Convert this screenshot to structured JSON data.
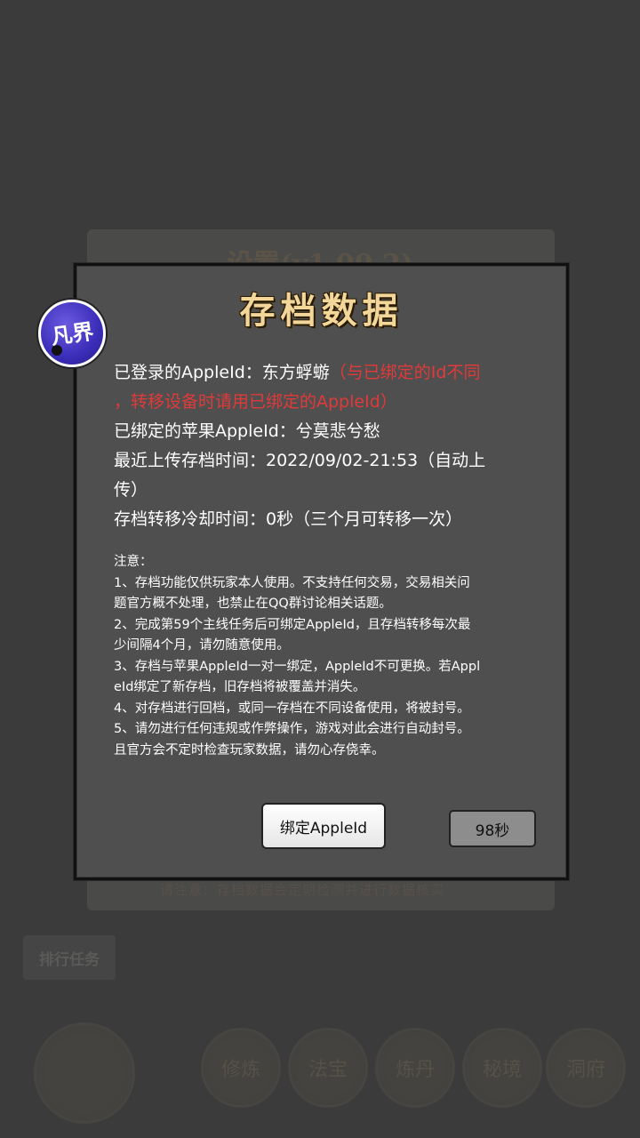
{
  "background": {
    "title": "设置(v1.00.2)",
    "hint": "请注意：存档数据会定期检测并进行数据核实",
    "button_label": "排行任务",
    "circle_labels": [
      "修炼",
      "法宝",
      "炼丹",
      "秘境",
      "洞府"
    ]
  },
  "dialog": {
    "title": "存档数据",
    "avatar_text": "凡界",
    "logged_in_label": "已登录的AppleId：",
    "logged_in_value": "东方蜉蝣",
    "logged_in_warning_1": "（与已绑定的Id不同",
    "logged_in_warning_2": "，转移设备时请用已绑定的AppleId）",
    "bound_line": "已绑定的苹果AppleId：兮莫悲兮愁",
    "upload_line_1": "最近上传存档时间：2022/09/02-21:53（自动上",
    "upload_line_2": "传）",
    "cooldown_line": "存档转移冷却时间：0秒（三个月可转移一次）",
    "notes": [
      "注意：",
      "1、存档功能仅供玩家本人使用。不支持任何交易，交易相关问",
      "题官方概不处理，也禁止在QQ群讨论相关话题。",
      "2、完成第59个主线任务后可绑定AppleId，且存档转移每次最",
      "少间隔4个月，请勿随意使用。",
      "3、存档与苹果AppleId一对一绑定，AppleId不可更换。若Appl",
      "eId绑定了新存档，旧存档将被覆盖并消失。",
      "4、对存档进行回档，或同一存档在不同设备使用，将被封号。",
      "5、请勿进行任何违规或作弊操作，游戏对此会进行自动封号。",
      "且官方会不定时检查玩家数据，请勿心存侥幸。"
    ],
    "bind_button": "绑定AppleId",
    "timer_button": "98秒"
  }
}
